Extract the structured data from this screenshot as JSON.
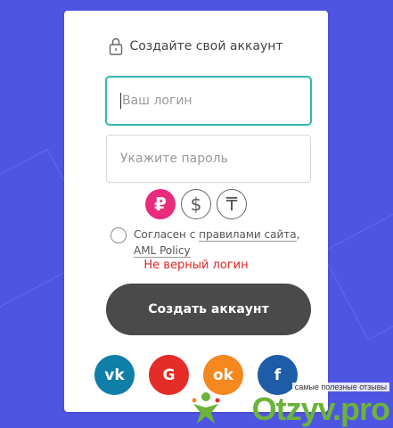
{
  "card": {
    "title": "Создайте свой аккаунт",
    "login": {
      "placeholder": "Ваш логин",
      "value": ""
    },
    "password": {
      "placeholder": "Укажите пароль",
      "value": ""
    },
    "currencies": [
      {
        "icon": "ruble-icon",
        "symbol": "₽",
        "selected": true
      },
      {
        "icon": "dollar-icon",
        "symbol": "$",
        "selected": false
      },
      {
        "icon": "tenge-icon",
        "symbol": "₸",
        "selected": false
      }
    ],
    "agreement": {
      "prefix": "Согласен с",
      "rules_link": "правилами сайта",
      "separator": ",",
      "aml_link": "AML Policy"
    },
    "error": "Не верный логин",
    "submit_label": "Создать аккаунт",
    "socials": [
      {
        "name": "vk",
        "icon": "vk-icon",
        "label": "vk",
        "color": "#0f7ea9"
      },
      {
        "name": "google",
        "icon": "google-icon",
        "label": "G",
        "color": "#e52d27"
      },
      {
        "name": "odnoklassniki",
        "icon": "odnoklassniki-icon",
        "label": "ok",
        "color": "#f5881f"
      },
      {
        "name": "facebook",
        "icon": "facebook-icon",
        "label": "f",
        "color": "#1f5ca8"
      }
    ]
  },
  "watermark": {
    "tagline": "самые полезные отзывы",
    "logo": "Otzyv.pro"
  },
  "colors": {
    "background": "#4f55e3",
    "accent_focus": "#2fb8b0",
    "error": "#e52525",
    "submit": "#4a4a4a"
  }
}
